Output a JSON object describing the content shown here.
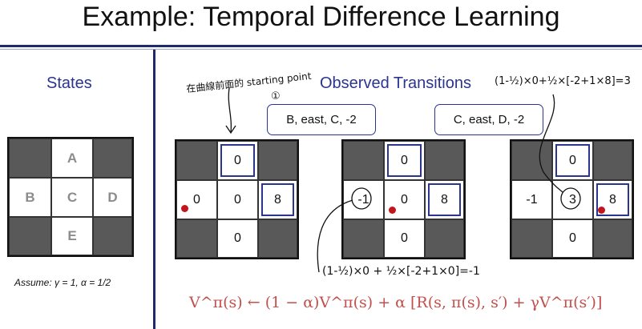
{
  "title": "Example: Temporal Difference Learning",
  "states_heading": "States",
  "observed_heading": "Observed Transitions",
  "state_letters": {
    "A": "A",
    "B": "B",
    "C": "C",
    "D": "D",
    "E": "E"
  },
  "transitions": [
    "B, east, C, -2",
    "C, east, D, -2"
  ],
  "grids": [
    {
      "top": "0",
      "left": "0",
      "center": "0",
      "right": "8",
      "bottom": "0"
    },
    {
      "top": "0",
      "left": "-1",
      "center": "0",
      "right": "8",
      "bottom": "0"
    },
    {
      "top": "0",
      "left": "-1",
      "center": "3",
      "right": "8",
      "bottom": "0"
    }
  ],
  "assume": "Assume: γ = 1, α = 1/2",
  "formula": "V^π(s) ← (1 − α)V^π(s) + α [R(s, π(s), s′) + γV^π(s′)]",
  "annotations": {
    "note_top_left": "在曲線前面的 starting point",
    "note_circled_one": "①",
    "note_calc_right": "(1-½)×0+½×[-2+1×8]=3",
    "note_calc_bottom": "(1-½)×0 + ½×[-2+1×0]=-1"
  },
  "colors": {
    "accent": "#2a3590",
    "dark_cell": "#595959",
    "agent_dot": "#c0161c",
    "formula": "#c0504d"
  }
}
